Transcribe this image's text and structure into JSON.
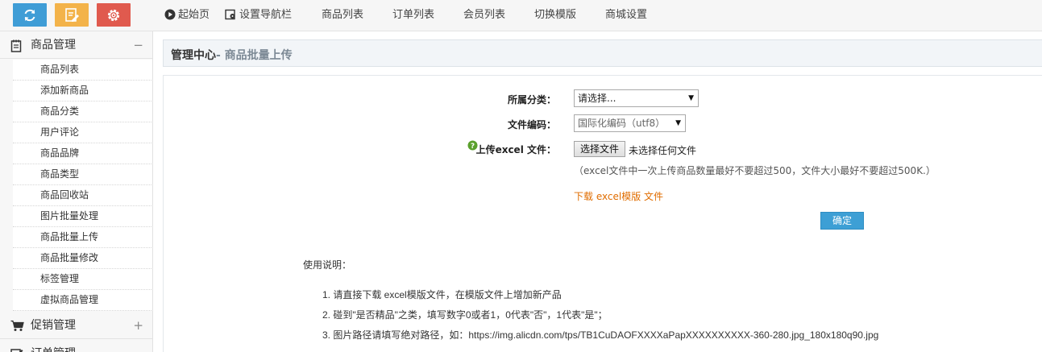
{
  "toolbar": {
    "buttons": [
      {
        "icon": "refresh-icon",
        "color": "#3f9dd6"
      },
      {
        "icon": "edit-note-icon",
        "color": "#f3b34a"
      },
      {
        "icon": "gear-icon",
        "color": "#e05a4e"
      }
    ],
    "nav": [
      {
        "label": "起始页",
        "icon": "play-circle-icon"
      },
      {
        "label": "设置导航栏",
        "icon": "settings-nav-icon"
      },
      {
        "label": "商品列表"
      },
      {
        "label": "订单列表"
      },
      {
        "label": "会员列表"
      },
      {
        "label": "切换模版"
      },
      {
        "label": "商城设置"
      }
    ]
  },
  "sidebar": {
    "groups": [
      {
        "label": "商品管理",
        "icon": "notepad-icon",
        "toggle": "−",
        "items": [
          "商品列表",
          "添加新商品",
          "商品分类",
          "用户评论",
          "商品品牌",
          "商品类型",
          "商品回收站",
          "图片批量处理",
          "商品批量上传",
          "商品批量修改",
          "标签管理",
          "虚拟商品管理"
        ]
      },
      {
        "label": "促销管理",
        "icon": "cart-icon",
        "toggle": "+"
      },
      {
        "label": "订单管理",
        "icon": "order-edit-icon",
        "toggle": "+"
      }
    ]
  },
  "header": {
    "title": "管理中心",
    "subtitle": "- 商品批量上传"
  },
  "form": {
    "category_label": "所属分类：",
    "category_value": "请选择...",
    "encoding_label": "文件编码：",
    "encoding_value": "国际化编码（utf8）",
    "upload_label": "上传excel 文件：",
    "choose_file_button": "选择文件",
    "no_file_text": "未选择任何文件",
    "hint": "（excel文件中一次上传商品数量最好不要超过500，文件大小最好不要超过500K.）",
    "download_link": "下载 excel模版 文件",
    "confirm_button": "确定"
  },
  "usage": {
    "title": "使用说明：",
    "steps": [
      "1.  请直接下载 excel模版文件，在模版文件上增加新产品",
      "2.  碰到\"是否精品\"之类，填写数字0或者1，0代表\"否\"，1代表\"是\"；",
      "3.  图片路径请填写绝对路径，如：https://img.alicdn.com/tps/TB1CuDAOFXXXXaPapXXXXXXXXXX-360-280.jpg_180x180q90.jpg"
    ]
  },
  "colors": {
    "accent": "#3d9fd5",
    "link": "#e06d00",
    "help_icon": "#5aa02c"
  }
}
